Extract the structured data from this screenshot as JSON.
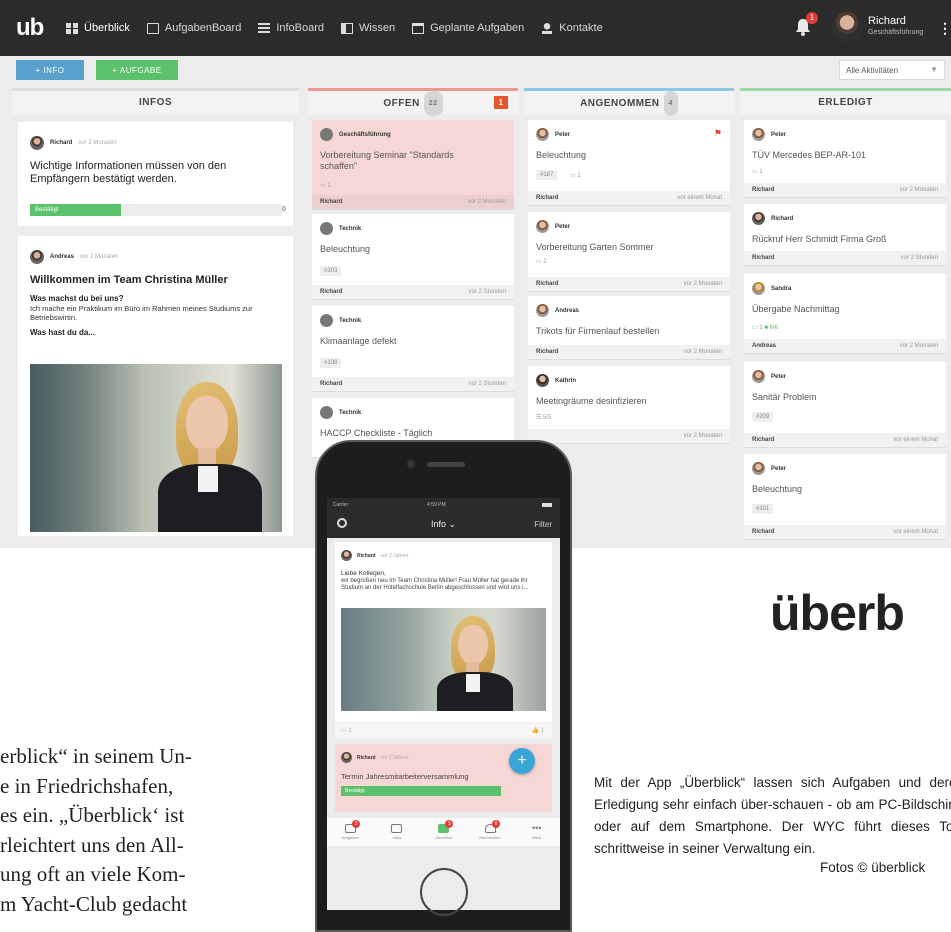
{
  "topbar": {
    "logo": "ub",
    "nav": [
      {
        "label": "Überblick",
        "icon": "grid-icon",
        "active": true
      },
      {
        "label": "AufgabenBoard",
        "icon": "checkbox-icon"
      },
      {
        "label": "InfoBoard",
        "icon": "list-icon"
      },
      {
        "label": "Wissen",
        "icon": "book-icon"
      },
      {
        "label": "Geplante Aufgaben",
        "icon": "calendar-icon"
      },
      {
        "label": "Kontakte",
        "icon": "user-icon"
      }
    ],
    "notification_count": "1",
    "user_name": "Richard",
    "user_role": "Geschäftsführung"
  },
  "toolbar": {
    "info_button": "+  INFO",
    "task_button": "+  AUFGABE",
    "activity_filter": "Alle Aktivitäten"
  },
  "columns": {
    "infos": {
      "title": "INFOS"
    },
    "offen": {
      "title": "OFFEN",
      "count": "22",
      "alert": "1"
    },
    "angenommen": {
      "title": "ANGENOMMEN",
      "count": "4"
    },
    "erledigt": {
      "title": "ERLEDIGT"
    }
  },
  "infos": {
    "card1": {
      "author": "Richard",
      "time": "vor 2 Monaten",
      "title": "Wichtige Informationen müssen von den Empfängern bestätigt werden.",
      "confirm_label": "Bestätigt",
      "confirm_count": "6"
    },
    "card2": {
      "author": "Andreas",
      "time": "vor 2 Monaten",
      "title": "Willkommen im Team Christina Müller",
      "q1": "Was machst du bei uns?",
      "a1": "Ich mache ein Praktikum im Büro im Rahmen meines Studiums zur Betriebswirtin.",
      "q2": "Was hast du da..."
    }
  },
  "offen_cards": [
    {
      "author": "Geschäftsführung",
      "title": "Vorbereitung Seminar \"Standards schaffen\"",
      "meta": "1",
      "user": "Richard",
      "time": "vor 2 Monaten"
    },
    {
      "author": "Technik",
      "title": "Beleuchtung",
      "tag": "#203",
      "user": "Richard",
      "time": "vor 2 Stunden"
    },
    {
      "author": "Technik",
      "title": "Klimaanlage defekt",
      "tag": "#108",
      "user": "Richard",
      "time": "vor 2 Stunden"
    },
    {
      "author": "Technik",
      "title": "HACCP Checkliste - Täglich"
    }
  ],
  "angenommen_cards": [
    {
      "author": "Peter",
      "title": "Beleuchtung",
      "tag": "#187",
      "meta": "1",
      "user": "Richard",
      "time": "vor einem Monat"
    },
    {
      "author": "Peter",
      "title": "Vorbereitung Garten Sommer",
      "meta": "2",
      "user": "Richard",
      "time": "vor 2 Monaten"
    },
    {
      "author": "Andreas",
      "title": "Trikots für Firmenlauf bestellen",
      "user": "Richard",
      "time": "vor 2 Monaten"
    },
    {
      "author": "Kathrin",
      "title": "Meetingräume desinfizieren",
      "meta": "5/5",
      "user": "",
      "time": "vor 2 Monaten"
    }
  ],
  "erledigt_cards": [
    {
      "author": "Peter",
      "title": "TÜV Mercedes BEP-AR-101",
      "meta": "1",
      "user": "Richard",
      "time": "vor 2 Monaten"
    },
    {
      "author": "Richard",
      "title": "Rückruf Herr Schmidt Firma Groß",
      "user": "Richard",
      "time": "vor 2 Stunden"
    },
    {
      "author": "Sandra",
      "title": "Übergabe Nachmittag",
      "meta": "1",
      "meta2": "6/6",
      "user": "Andreas",
      "time": "vor 2 Monaten"
    },
    {
      "author": "Peter",
      "title": "Sanitär Problem",
      "tag": "#209",
      "user": "Richard",
      "time": "vor einem Monat"
    },
    {
      "author": "Peter",
      "title": "Beleuchtung",
      "tag": "#101",
      "user": "Richard",
      "time": "vor einem Monat"
    }
  ],
  "phone": {
    "carrier": "Carrier",
    "clock": "4:59 PM",
    "title": "Info ⌄",
    "filter": "Filter",
    "post": {
      "author": "Richard",
      "time": "vor 2 Jahren",
      "greeting": "Liebe Kollegen,",
      "body": "wir begrüßen neu im Team Christina Müller! Frau Müller hat gerade ihr Studium an der Hotelfachschule Berlin abgeschlossen und wird uns i..."
    },
    "comments": "1",
    "likes": "1",
    "task": {
      "author": "Richard",
      "time": "vor 2 Jahren",
      "title": "Termin Jahresmitarbeiterversammlung",
      "bar_label": "Bestätigt"
    },
    "fab": "+",
    "tabs": [
      {
        "label": "Aufgaben",
        "badge": "2"
      },
      {
        "label": "Infos",
        "badge": ""
      },
      {
        "label": "Überblick",
        "badge": "5"
      },
      {
        "label": "Nachrichten",
        "badge": "6"
      },
      {
        "label": "Mehr",
        "badge": ""
      }
    ]
  },
  "brand": "überb",
  "caption": "Mit der App „Überblick“ lassen sich Aufgaben und deren Erledigung sehr einfach über-schauen - ob am PC-Bildschirm oder auf dem Smartphone. Der WYC führt dieses Tool schrittweise in seiner Verwaltung ein.",
  "credit": "Fotos © überblick",
  "article": [
    "erblick“ in seinem Un-",
    "e in Friedrichshafen,",
    "es ein. „Überblick‘ ist",
    "rleichtert uns den All-",
    "ung oft an viele Kom-",
    "m Yacht-Club gedacht"
  ]
}
